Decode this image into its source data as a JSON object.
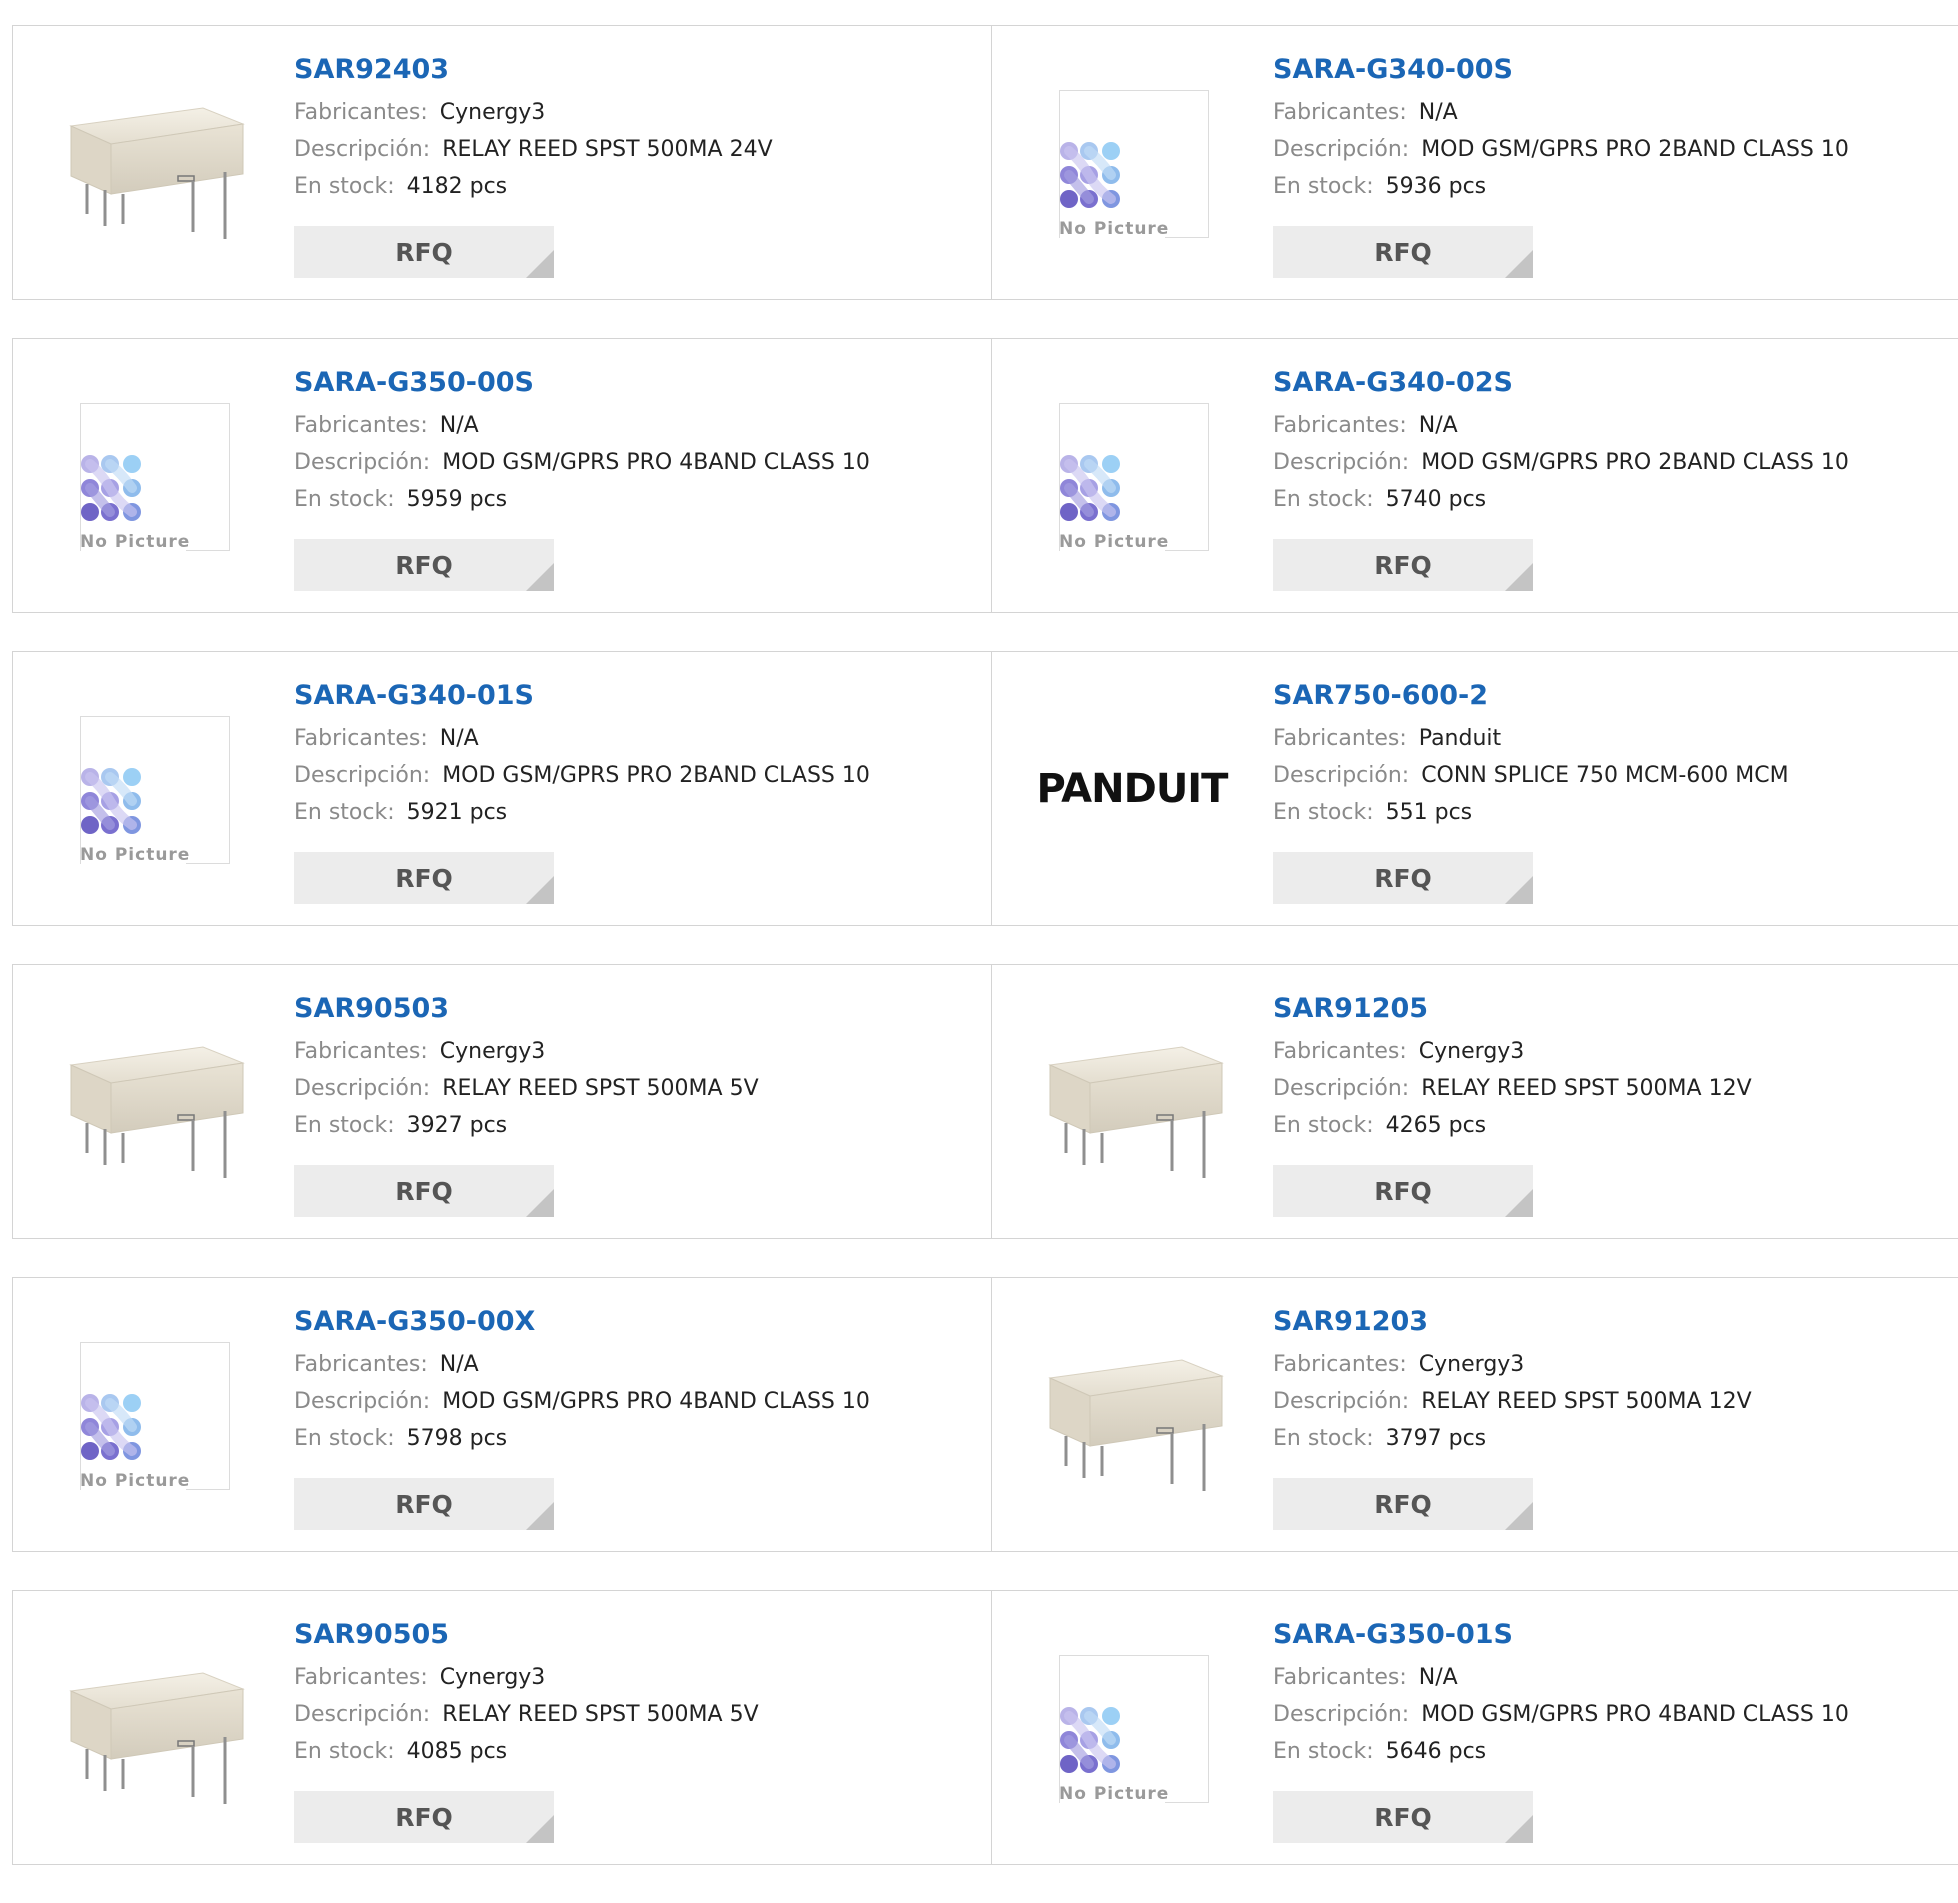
{
  "labels": {
    "manufacturer": "Fabricantes:",
    "description": "Descripción:",
    "stock": "En stock:",
    "rfq": "RFQ",
    "no_picture": "No Picture"
  },
  "colors": {
    "part_link": "#1b66b5",
    "label_gray": "#8a8a8a",
    "rfq_bg": "#ececec"
  },
  "products": [
    {
      "part": "SAR92403",
      "manufacturer": "Cynergy3",
      "description": "RELAY REED SPST 500MA 24V",
      "stock": "4182 pcs",
      "image": "relay"
    },
    {
      "part": "SARA-G340-00S",
      "manufacturer": "N/A",
      "description": "MOD GSM/GPRS PRO 2BAND CLASS 10",
      "stock": "5936 pcs",
      "image": "no-picture"
    },
    {
      "part": "SARA-G350-00S",
      "manufacturer": "N/A",
      "description": "MOD GSM/GPRS PRO 4BAND CLASS 10",
      "stock": "5959 pcs",
      "image": "no-picture"
    },
    {
      "part": "SARA-G340-02S",
      "manufacturer": "N/A",
      "description": "MOD GSM/GPRS PRO 2BAND CLASS 10",
      "stock": "5740 pcs",
      "image": "no-picture"
    },
    {
      "part": "SARA-G340-01S",
      "manufacturer": "N/A",
      "description": "MOD GSM/GPRS PRO 2BAND CLASS 10",
      "stock": "5921 pcs",
      "image": "no-picture"
    },
    {
      "part": "SAR750-600-2",
      "manufacturer": "Panduit",
      "description": "CONN SPLICE 750 MCM-600 MCM",
      "stock": "551 pcs",
      "image": "panduit-logo",
      "logo_text": "PANDUIT"
    },
    {
      "part": "SAR90503",
      "manufacturer": "Cynergy3",
      "description": "RELAY REED SPST 500MA 5V",
      "stock": "3927 pcs",
      "image": "relay"
    },
    {
      "part": "SAR91205",
      "manufacturer": "Cynergy3",
      "description": "RELAY REED SPST 500MA 12V",
      "stock": "4265 pcs",
      "image": "relay"
    },
    {
      "part": "SARA-G350-00X",
      "manufacturer": "N/A",
      "description": "MOD GSM/GPRS PRO 4BAND CLASS 10",
      "stock": "5798 pcs",
      "image": "no-picture"
    },
    {
      "part": "SAR91203",
      "manufacturer": "Cynergy3",
      "description": "RELAY REED SPST 500MA 12V",
      "stock": "3797 pcs",
      "image": "relay"
    },
    {
      "part": "SAR90505",
      "manufacturer": "Cynergy3",
      "description": "RELAY REED SPST 500MA 5V",
      "stock": "4085 pcs",
      "image": "relay"
    },
    {
      "part": "SARA-G350-01S",
      "manufacturer": "N/A",
      "description": "MOD GSM/GPRS PRO 4BAND CLASS 10",
      "stock": "5646 pcs",
      "image": "no-picture"
    }
  ]
}
